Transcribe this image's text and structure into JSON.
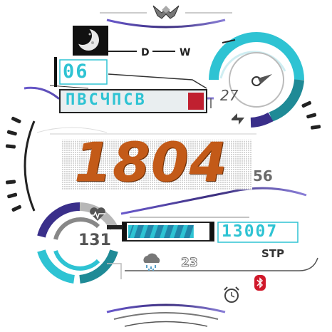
{
  "time": {
    "hhmm": "1804",
    "seconds": "56"
  },
  "date": {
    "day": "06",
    "month": "ΠΒСЧΠСΒ",
    "d_label": "D",
    "w_label": "W"
  },
  "weather": {
    "temperature": "27",
    "forecast_temp": "23"
  },
  "status": {
    "battery": "131",
    "steps": "13007",
    "steps_unit": "STP"
  },
  "icons": {
    "logo": "wing-logo-icon",
    "moon": "moon-phase-icon",
    "power": "lightning-icon",
    "heart": "heart-rate-icon",
    "cloud": "rain-cloud-icon",
    "bluetooth": "bluetooth-icon",
    "alarm": "alarm-clock-icon"
  },
  "colors": {
    "accent": "#2ec3d3",
    "accent_dark": "#1f8a96",
    "time": "#c35a18",
    "purple": "#3a2f8a",
    "bluetooth": "#d0182a"
  },
  "levels": {
    "step_goal_fraction": 0.82
  }
}
